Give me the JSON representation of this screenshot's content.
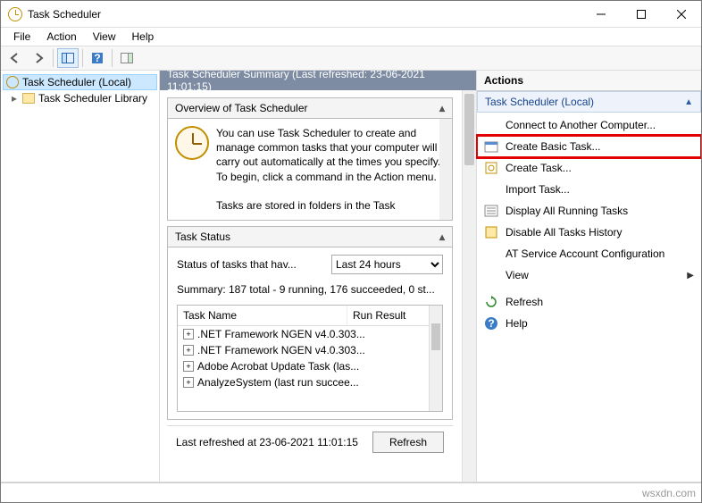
{
  "window": {
    "title": "Task Scheduler"
  },
  "menu": {
    "file": "File",
    "action": "Action",
    "view": "View",
    "help": "Help"
  },
  "tree": {
    "root": "Task Scheduler (Local)",
    "child": "Task Scheduler Library"
  },
  "summary": {
    "header": "Task Scheduler Summary (Last refreshed: 23-06-2021 11:01:15)",
    "overview_title": "Overview of Task Scheduler",
    "overview_text": "You can use Task Scheduler to create and manage common tasks that your computer will carry out automatically at the times you specify. To begin, click a command in the Action menu.",
    "overview_truncated": "Tasks are stored in folders in the Task",
    "status_title": "Task Status",
    "status_label": "Status of tasks that hav...",
    "status_period_options": [
      "Last 24 hours"
    ],
    "status_period": "Last 24 hours",
    "status_summary": "Summary: 187 total - 9 running, 176 succeeded, 0 st...",
    "table_cols": {
      "name": "Task Name",
      "result": "Run Result"
    },
    "tasks": [
      ".NET Framework NGEN v4.0.303...",
      ".NET Framework NGEN v4.0.303...",
      "Adobe Acrobat Update Task (las...",
      "AnalyzeSystem (last run succee..."
    ],
    "footer_text": "Last refreshed at 23-06-2021 11:01:15",
    "refresh_btn": "Refresh"
  },
  "actions": {
    "title": "Actions",
    "header": "Task Scheduler (Local)",
    "items": [
      {
        "label": "Connect to Another Computer...",
        "icon": ""
      },
      {
        "label": "Create Basic Task...",
        "icon": "wizard",
        "highlight": true
      },
      {
        "label": "Create Task...",
        "icon": "task"
      },
      {
        "label": "Import Task...",
        "icon": ""
      },
      {
        "label": "Display All Running Tasks",
        "icon": "list"
      },
      {
        "label": "Disable All Tasks History",
        "icon": "history"
      },
      {
        "label": "AT Service Account Configuration",
        "icon": ""
      },
      {
        "label": "View",
        "icon": "",
        "submenu": true
      },
      {
        "label": "Refresh",
        "icon": "refresh"
      },
      {
        "label": "Help",
        "icon": "help"
      }
    ]
  },
  "watermark": "wsxdn.com"
}
